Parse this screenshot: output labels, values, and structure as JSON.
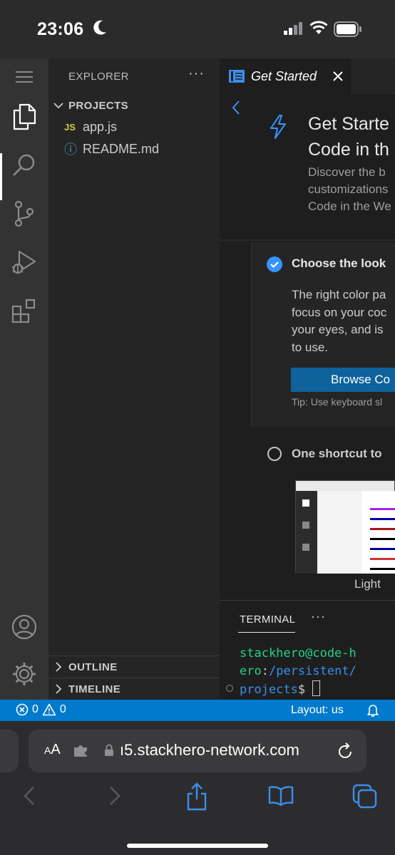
{
  "status_bar": {
    "time": "23:06"
  },
  "explorer": {
    "title": "EXPLORER",
    "more": "···",
    "section_label": "PROJECTS",
    "files": [
      {
        "icon_text": "JS",
        "name": "app.js"
      },
      {
        "icon_text": "ⓘ",
        "name": "README.md"
      }
    ],
    "outline_label": "OUTLINE",
    "timeline_label": "TIMELINE"
  },
  "tab": {
    "label": "Get Started"
  },
  "welcome": {
    "title_line1": "Get Starte",
    "title_line2": "Code in th",
    "sub_line1": "Discover the b",
    "sub_line2": "customizations",
    "sub_line3": "Code in the We",
    "step1_title": "Choose the look",
    "step1_desc_line1": "The right color pa",
    "step1_desc_line2": "focus on your coc",
    "step1_desc_line3": "your eyes, and is",
    "step1_desc_line4": "to use.",
    "step1_button": "Browse Co",
    "step1_tip": "Tip: Use keyboard sl",
    "step2_title": "One shortcut to",
    "preview_label": "Light"
  },
  "panel": {
    "tab_label": "TERMINAL",
    "more": "···",
    "prompt_user_line1": "stackhero@code-h",
    "prompt_user_line2": "ero",
    "prompt_colon": ":",
    "prompt_path_line1": "/persistent/",
    "prompt_path_line2": "projects",
    "prompt_dollar": "$ "
  },
  "status_line": {
    "errors": "0",
    "warnings": "0",
    "layout": "Layout: us"
  },
  "safari": {
    "aa_small": "A",
    "aa_big": "A",
    "url": "ı5.stackhero-network.com"
  },
  "colors": {
    "accent": "#007acc",
    "button": "#0e639c",
    "terminal_green": "#23d18b",
    "terminal_blue": "#3b8eea"
  }
}
